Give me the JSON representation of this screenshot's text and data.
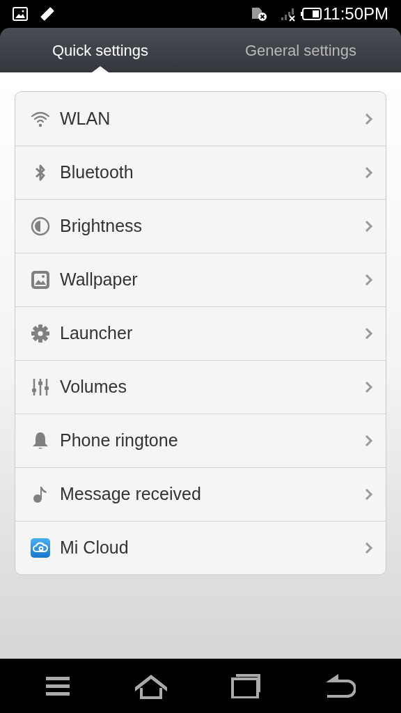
{
  "status_bar": {
    "time": "11:50PM"
  },
  "tabs": [
    {
      "label": "Quick settings",
      "selected": true
    },
    {
      "label": "General settings",
      "selected": false
    }
  ],
  "items": [
    {
      "label": "WLAN",
      "kind": "wifi"
    },
    {
      "label": "Bluetooth",
      "kind": "bluetooth"
    },
    {
      "label": "Brightness",
      "kind": "brightness"
    },
    {
      "label": "Wallpaper",
      "kind": "wallpaper"
    },
    {
      "label": "Launcher",
      "kind": "gear"
    },
    {
      "label": "Volumes",
      "kind": "sliders"
    },
    {
      "label": "Phone ringtone",
      "kind": "bell"
    },
    {
      "label": "Message received",
      "kind": "note"
    },
    {
      "label": "Mi Cloud",
      "kind": "cloud"
    }
  ]
}
